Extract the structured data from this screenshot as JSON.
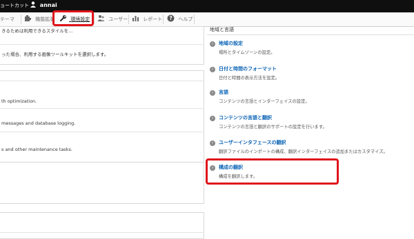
{
  "topbar": {
    "shortcut_label": "ョートカット",
    "user_label": "annai"
  },
  "toolbar": {
    "items": [
      {
        "label": "テーマ",
        "icon": "brush-icon"
      },
      {
        "label": "機能拡張",
        "icon": "puzzle-icon"
      },
      {
        "label": "環境設定",
        "icon": "wrench-icon",
        "active": true
      },
      {
        "label": "ユーザー",
        "icon": "users-icon"
      },
      {
        "label": "レポート",
        "icon": "bar-chart-icon"
      },
      {
        "label": "ヘルプ",
        "icon": "help-icon"
      }
    ]
  },
  "left": {
    "line1": "きるためは利用できるスタイルを...",
    "line2": "った場合、利用する画像ツールキットを選択します。",
    "line3": "th optimization.",
    "line4": "messages and database logging.",
    "line5": "s and other maintenance tasks."
  },
  "right": {
    "section_title": "地域と言語",
    "items": [
      {
        "title": "地域の設定",
        "desc": "場所とタイムゾーンの設定。"
      },
      {
        "title": "日付と時間のフォーマット",
        "desc": "日付と時間の表示方法を設定。"
      },
      {
        "title": "言語",
        "desc": "コンテンツの言語とインターフェイスの設定。"
      },
      {
        "title": "コンテンツの言語と翻訳",
        "desc": "コンテンツの言語と翻訳のサポートの設定を行います。"
      },
      {
        "title": "ユーザーインタフェースの翻訳",
        "desc": "翻訳ファイルのインポートの構成、翻訳インターフェイスの追加またはカスタマイズ。"
      },
      {
        "title": "構成の翻訳",
        "desc": "構成を翻訳します。"
      }
    ]
  },
  "colors": {
    "highlight": "#e0131a",
    "link": "#0a63b5",
    "topbar": "#0f0f0f"
  }
}
